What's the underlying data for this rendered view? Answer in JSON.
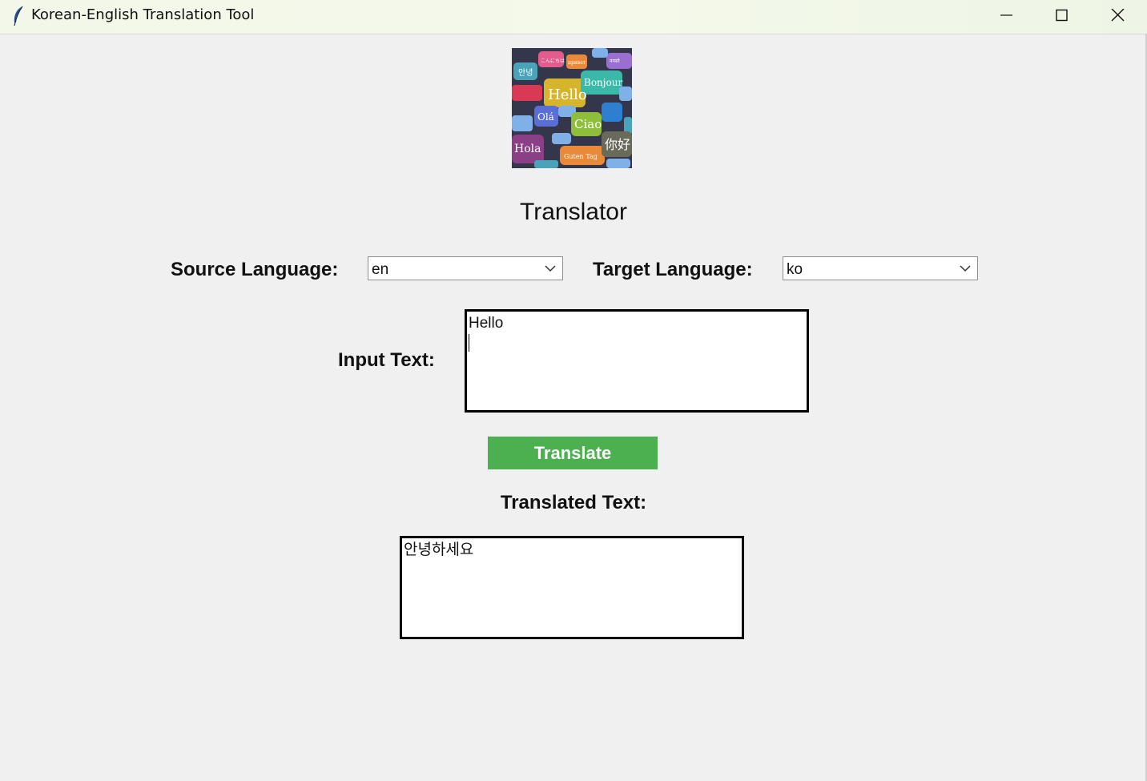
{
  "window": {
    "title": "Korean-English Translation Tool"
  },
  "logo": {
    "words": [
      "Hello",
      "Bonjour",
      "Olá",
      "Ciao",
      "Hola",
      "Guten Tag",
      "你好",
      "안녕",
      "привет",
      "こんにちは",
      "नमस्ते"
    ]
  },
  "heading": "Translator",
  "source": {
    "label": "Source Language:",
    "value": "en"
  },
  "target": {
    "label": "Target Language:",
    "value": "ko"
  },
  "input": {
    "label": "Input Text:",
    "value": "Hello"
  },
  "translate_button": {
    "label": "Translate",
    "color": "#4caf50"
  },
  "output": {
    "label": "Translated Text:",
    "value": "안녕하세요"
  }
}
